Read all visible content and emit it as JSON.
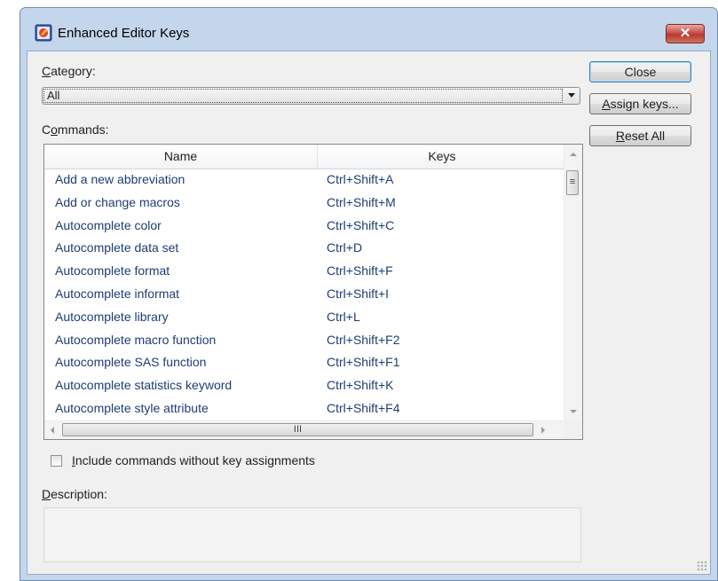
{
  "window": {
    "title": "Enhanced Editor Keys",
    "close_glyph": "✕"
  },
  "category": {
    "label_u": "C",
    "label_rest": "ategory:",
    "selected": "All"
  },
  "buttons": {
    "close": "Close",
    "assign_u": "A",
    "assign_rest": "ssign keys...",
    "reset_u": "R",
    "reset_rest": "eset All"
  },
  "commands": {
    "label_pre": "C",
    "label_u": "o",
    "label_rest": "mmands:",
    "columns": [
      "Name",
      "Keys"
    ],
    "rows": [
      {
        "name": "Add a new abbreviation",
        "keys": "Ctrl+Shift+A"
      },
      {
        "name": "Add or change macros",
        "keys": "Ctrl+Shift+M"
      },
      {
        "name": "Autocomplete color",
        "keys": "Ctrl+Shift+C"
      },
      {
        "name": "Autocomplete data set",
        "keys": "Ctrl+D"
      },
      {
        "name": "Autocomplete format",
        "keys": "Ctrl+Shift+F"
      },
      {
        "name": "Autocomplete informat",
        "keys": "Ctrl+Shift+I"
      },
      {
        "name": "Autocomplete library",
        "keys": "Ctrl+L"
      },
      {
        "name": "Autocomplete macro function",
        "keys": "Ctrl+Shift+F2"
      },
      {
        "name": "Autocomplete SAS function",
        "keys": "Ctrl+Shift+F1"
      },
      {
        "name": "Autocomplete statistics keyword",
        "keys": "Ctrl+Shift+K"
      },
      {
        "name": "Autocomplete style attribute",
        "keys": "Ctrl+Shift+F4"
      }
    ]
  },
  "include_checkbox": {
    "label_u": "I",
    "label_rest": "nclude commands without key assignments",
    "checked": false
  },
  "description": {
    "label_u": "D",
    "label_rest": "escription:",
    "text": ""
  },
  "colors": {
    "title_bg": "#c4d6ec",
    "close_red": "#c75050",
    "link_text": "#1e3d73"
  },
  "icons": {
    "app": "sas-app-icon",
    "vthumb_grip": "≡",
    "hthumb_grip": "III"
  }
}
